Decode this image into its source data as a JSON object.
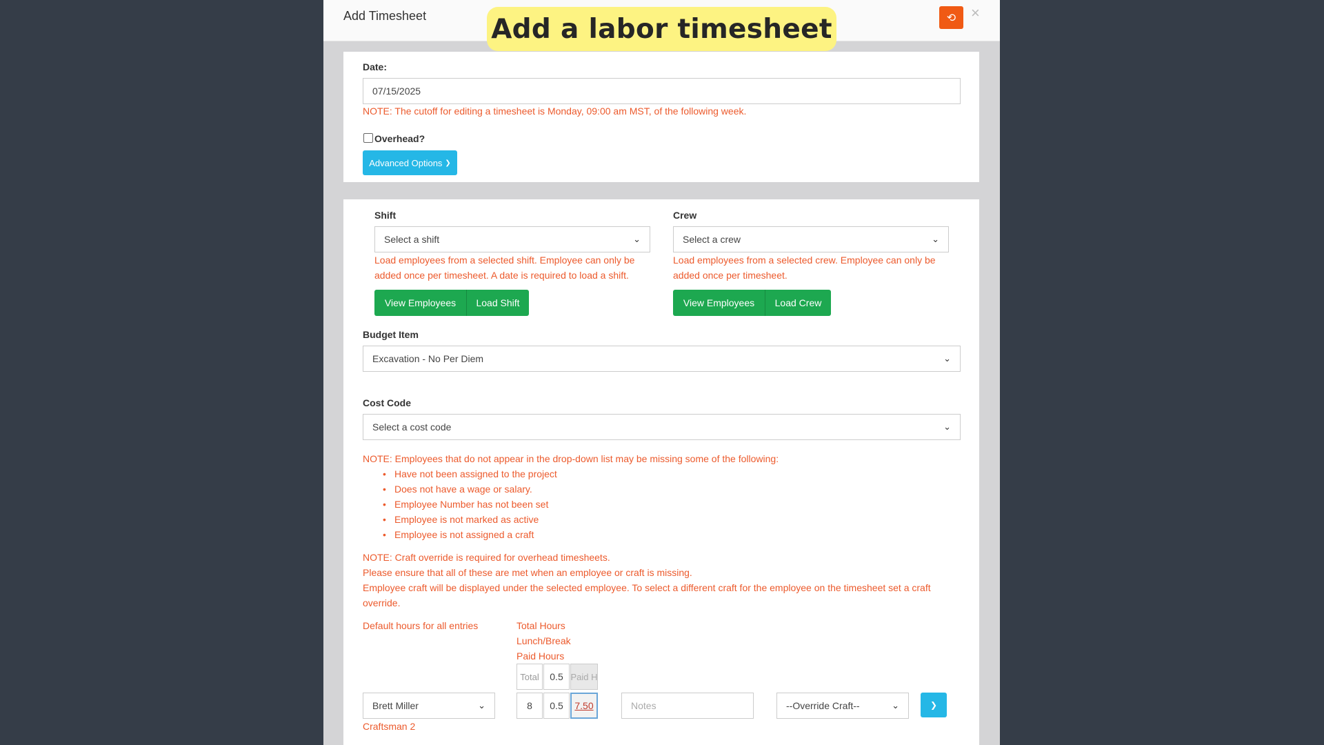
{
  "modal": {
    "title": "Add Timesheet",
    "banner": "Add a labor timesheet",
    "reset_icon": "⟲",
    "close_icon": "×"
  },
  "date": {
    "label": "Date:",
    "value": "07/15/2025",
    "note": "NOTE: The cutoff for editing a timesheet is Monday, 09:00 am MST, of the following week."
  },
  "overhead": {
    "label": "Overhead?",
    "checked": false
  },
  "advanced_options": {
    "label": "Advanced Options",
    "icon": "❯"
  },
  "shift": {
    "label": "Shift",
    "placeholder": "Select a shift",
    "note_line1": "Load employees from a selected shift. Employee can only be",
    "note_line2": "added once per timesheet. A date is required to load a shift.",
    "view_label": "View Employees",
    "load_label": "Load Shift"
  },
  "crew": {
    "label": "Crew",
    "placeholder": "Select a crew",
    "note_line1": "Load employees from a selected crew. Employee can only be",
    "note_line2": "added once per timesheet.",
    "view_label": "View Employees",
    "load_label": "Load Crew"
  },
  "budget_item": {
    "label": "Budget Item",
    "value": "Excavation - No Per Diem"
  },
  "cost_code": {
    "label": "Cost Code",
    "placeholder": "Select a cost code"
  },
  "employee_note": {
    "intro": "NOTE: Employees that do not appear in the drop-down list may be missing some of the following:",
    "reasons": [
      "Have not been assigned to the project",
      "Does not have a wage or salary.",
      "Employee Number has not been set",
      "Employee is not marked as active",
      "Employee is not assigned a craft"
    ],
    "craft_override": "NOTE: Craft override is required for overhead timesheets.",
    "ensure": "Please ensure that all of these are met when an employee or craft is missing.",
    "craft_line1": "Employee craft will be displayed under the selected employee. To select a different craft for the employee on the timesheet set a craft",
    "craft_line2": "override."
  },
  "defaults": {
    "label": "Default hours for all entries",
    "legend": [
      "Total Hours",
      "Lunch/Break",
      "Paid Hours"
    ],
    "total_placeholder": "Total",
    "lunch_value": "0.5",
    "paid_placeholder": "Paid H"
  },
  "entry": {
    "employee": "Brett Miller",
    "craft": "Craftsman 2",
    "total": "8",
    "lunch": "0.5",
    "paid": "7.50",
    "notes_placeholder": "Notes",
    "override_craft": "--Override Craft--",
    "next_icon": "❯"
  },
  "colors": {
    "accent_orange": "#f05a14",
    "note_red": "#ec5a2c",
    "green": "#1da850",
    "blue": "#25b7e6",
    "banner_yellow": "#fdf382"
  }
}
